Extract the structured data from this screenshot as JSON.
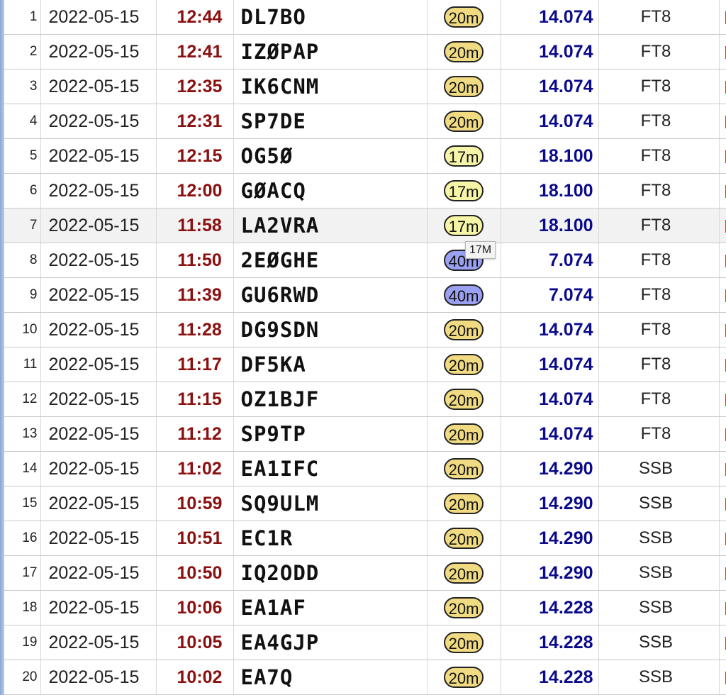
{
  "log": {
    "band_colors": {
      "20m": "#f0db82",
      "17m": "#f6f4a6",
      "40m": "#9aa0f2"
    },
    "rows": [
      {
        "num": "1",
        "date": "2022-05-15",
        "time": "12:44",
        "call": "DL7BO",
        "band": "20m",
        "freq": "14.074",
        "mode": "FT8"
      },
      {
        "num": "2",
        "date": "2022-05-15",
        "time": "12:41",
        "call": "IZØPAP",
        "band": "20m",
        "freq": "14.074",
        "mode": "FT8"
      },
      {
        "num": "3",
        "date": "2022-05-15",
        "time": "12:35",
        "call": "IK6CNM",
        "band": "20m",
        "freq": "14.074",
        "mode": "FT8"
      },
      {
        "num": "4",
        "date": "2022-05-15",
        "time": "12:31",
        "call": "SP7DE",
        "band": "20m",
        "freq": "14.074",
        "mode": "FT8"
      },
      {
        "num": "5",
        "date": "2022-05-15",
        "time": "12:15",
        "call": "OG5Ø",
        "band": "17m",
        "freq": "18.100",
        "mode": "FT8"
      },
      {
        "num": "6",
        "date": "2022-05-15",
        "time": "12:00",
        "call": "GØACQ",
        "band": "17m",
        "freq": "18.100",
        "mode": "FT8"
      },
      {
        "num": "7",
        "date": "2022-05-15",
        "time": "11:58",
        "call": "LA2VRA",
        "band": "17m",
        "freq": "18.100",
        "mode": "FT8",
        "hover": true
      },
      {
        "num": "8",
        "date": "2022-05-15",
        "time": "11:50",
        "call": "2EØGHE",
        "band": "40m",
        "freq": "7.074",
        "mode": "FT8"
      },
      {
        "num": "9",
        "date": "2022-05-15",
        "time": "11:39",
        "call": "GU6RWD",
        "band": "40m",
        "freq": "7.074",
        "mode": "FT8"
      },
      {
        "num": "10",
        "date": "2022-05-15",
        "time": "11:28",
        "call": "DG9SDN",
        "band": "20m",
        "freq": "14.074",
        "mode": "FT8"
      },
      {
        "num": "11",
        "date": "2022-05-15",
        "time": "11:17",
        "call": "DF5KA",
        "band": "20m",
        "freq": "14.074",
        "mode": "FT8"
      },
      {
        "num": "12",
        "date": "2022-05-15",
        "time": "11:15",
        "call": "OZ1BJF",
        "band": "20m",
        "freq": "14.074",
        "mode": "FT8"
      },
      {
        "num": "13",
        "date": "2022-05-15",
        "time": "11:12",
        "call": "SP9TP",
        "band": "20m",
        "freq": "14.074",
        "mode": "FT8"
      },
      {
        "num": "14",
        "date": "2022-05-15",
        "time": "11:02",
        "call": "EA1IFC",
        "band": "20m",
        "freq": "14.290",
        "mode": "SSB"
      },
      {
        "num": "15",
        "date": "2022-05-15",
        "time": "10:59",
        "call": "SQ9ULM",
        "band": "20m",
        "freq": "14.290",
        "mode": "SSB"
      },
      {
        "num": "16",
        "date": "2022-05-15",
        "time": "10:51",
        "call": "EC1R",
        "band": "20m",
        "freq": "14.290",
        "mode": "SSB"
      },
      {
        "num": "17",
        "date": "2022-05-15",
        "time": "10:50",
        "call": "IQ2ODD",
        "band": "20m",
        "freq": "14.290",
        "mode": "SSB"
      },
      {
        "num": "18",
        "date": "2022-05-15",
        "time": "10:06",
        "call": "EA1AF",
        "band": "20m",
        "freq": "14.228",
        "mode": "SSB"
      },
      {
        "num": "19",
        "date": "2022-05-15",
        "time": "10:05",
        "call": "EA4GJP",
        "band": "20m",
        "freq": "14.228",
        "mode": "SSB"
      },
      {
        "num": "20",
        "date": "2022-05-15",
        "time": "10:02",
        "call": "EA7Q",
        "band": "20m",
        "freq": "14.228",
        "mode": "SSB"
      }
    ]
  },
  "tooltip": {
    "text": "17M"
  }
}
